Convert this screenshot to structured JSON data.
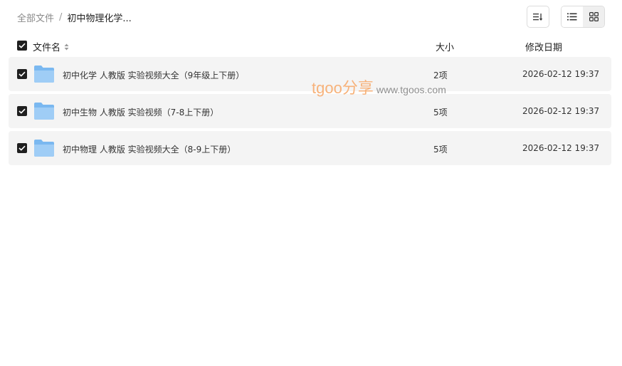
{
  "breadcrumb": {
    "root": "全部文件",
    "separator": "/",
    "current": "初中物理化学..."
  },
  "toolbar": {
    "sort_icon": "sort-lines-icon",
    "view_list_icon": "list-view-icon",
    "view_grid_icon": "grid-view-icon",
    "active_view": "list"
  },
  "table": {
    "headers": {
      "name": "文件名",
      "size": "大小",
      "date": "修改日期"
    },
    "rows": [
      {
        "name": "初中化学 人教版 实验视频大全（9年级上下册）",
        "size": "2项",
        "date": "2026-02-12 19:37",
        "checked": true,
        "icon": "folder-icon"
      },
      {
        "name": "初中生物 人教版 实验视频（7-8上下册）",
        "size": "5项",
        "date": "2026-02-12 19:37",
        "checked": true,
        "icon": "folder-icon"
      },
      {
        "name": "初中物理 人教版 实验视频大全（8-9上下册）",
        "size": "5项",
        "date": "2026-02-12 19:37",
        "checked": true,
        "icon": "folder-icon"
      }
    ]
  },
  "watermark": {
    "brand": "tgoo分享",
    "url": "www.tgoos.com"
  },
  "colors": {
    "row_bg": "#f4f4f4",
    "checkbox": "#1f1f1f",
    "folder": "#7ab8f0",
    "watermark_brand": "#f7b27a"
  }
}
